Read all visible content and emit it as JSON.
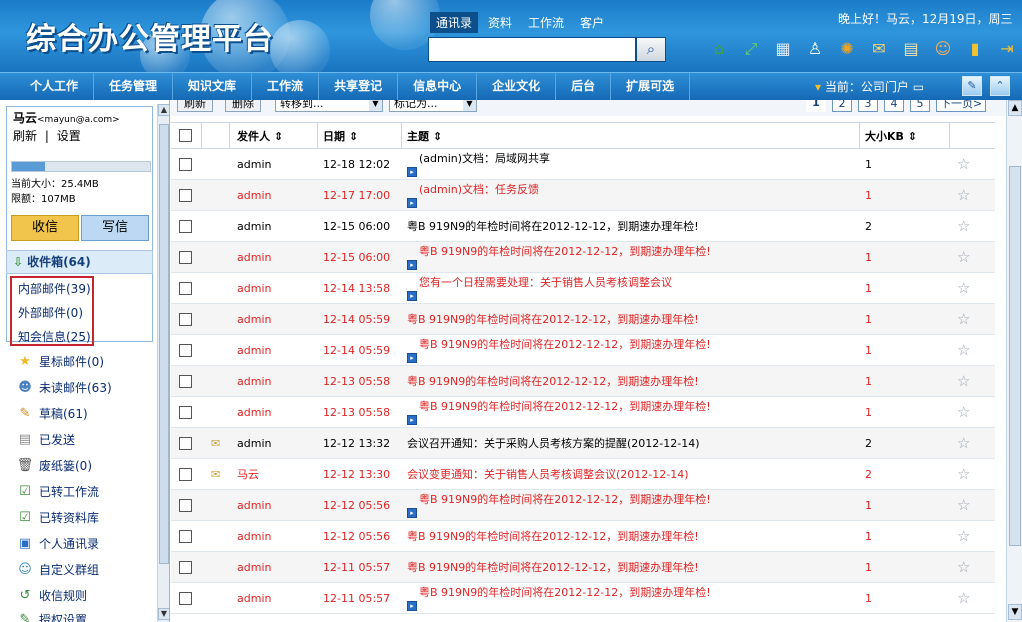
{
  "header": {
    "logo": "综合办公管理平台",
    "search_tabs": [
      "通讯录",
      "资料",
      "工作流",
      "客户"
    ],
    "active_search_tab": 0,
    "search_placeholder": "",
    "greeting": "晚上好！马云，12月19日，周三",
    "tool_icons": [
      "home-icon",
      "arrows-icon",
      "calendar-edit-icon",
      "shirt-icon",
      "gear-icon",
      "mail-icon",
      "calendar-icon",
      "people-icon",
      "notebook-icon",
      "exit-icon"
    ]
  },
  "nav": {
    "items": [
      "个人工作",
      "任务管理",
      "知识文库",
      "工作流",
      "共享登记",
      "信息中心",
      "企业文化",
      "后台",
      "扩展可选"
    ],
    "current": "当前：公司门户"
  },
  "left": {
    "user_name": "马云",
    "user_email": "<mayun@a.com>",
    "refresh": "刷新",
    "separator": "|",
    "settings": "设置",
    "quota_fill_fraction": 0.24,
    "current_size": "当前大小：25.4MB",
    "limit": "限额：107MB",
    "receive_btn": "收信",
    "write_btn": "写信",
    "inbox": "收件箱(64)",
    "sub_items": [
      "内部邮件(39)",
      "外部邮件(0)",
      "知会信息(25)"
    ],
    "menu_items": [
      {
        "label": "星标邮件(0)",
        "icon": "star-icon"
      },
      {
        "label": "未读邮件(63)",
        "icon": "unread-icon"
      },
      {
        "label": "草稿(61)",
        "icon": "draft-icon"
      },
      {
        "label": "已发送",
        "icon": "sent-icon"
      },
      {
        "label": "废纸篓(0)",
        "icon": "trash-icon"
      },
      {
        "label": "已转工作流",
        "icon": "workflow-icon"
      },
      {
        "label": "已转资料库",
        "icon": "library-icon"
      },
      {
        "label": "个人通讯录",
        "icon": "contacts-icon"
      },
      {
        "label": "自定义群组",
        "icon": "group-icon"
      },
      {
        "label": "收信规则",
        "icon": "rules-icon"
      },
      {
        "label": "授权设置",
        "icon": "auth-icon"
      }
    ]
  },
  "toolbar": {
    "refresh": "刷新",
    "delete": "删除",
    "move_to": "转移到...",
    "mark_as": "标记为...",
    "pages": [
      "1",
      "2",
      "3",
      "4",
      "5",
      "下一页>"
    ]
  },
  "table": {
    "headers": {
      "sender": "发件人 ⇕",
      "date": "日期 ⇕",
      "subject": "主题 ⇕",
      "size": "大小KB ⇕"
    },
    "rows": [
      {
        "sender": "admin",
        "date": "12-18 12:02",
        "subject": "(admin)文档：局域网共享",
        "size": "1",
        "red": false,
        "env": false,
        "flag": true
      },
      {
        "sender": "admin",
        "date": "12-17 17:00",
        "subject": "(admin)文档：任务反馈",
        "size": "1",
        "red": true,
        "env": false,
        "flag": true
      },
      {
        "sender": "admin",
        "date": "12-15 06:00",
        "subject": "粤B 919N9的年检时间将在2012-12-12，到期速办理年检!",
        "size": "2",
        "red": false,
        "env": false,
        "flag": false
      },
      {
        "sender": "admin",
        "date": "12-15 06:00",
        "subject": "粤B 919N9的年检时间将在2012-12-12，到期速办理年检!",
        "size": "1",
        "red": true,
        "env": false,
        "flag": true
      },
      {
        "sender": "admin",
        "date": "12-14 13:58",
        "subject": "您有一个日程需要处理：关于销售人员考核调整会议",
        "size": "1",
        "red": true,
        "env": false,
        "flag": true
      },
      {
        "sender": "admin",
        "date": "12-14 05:59",
        "subject": "粤B 919N9的年检时间将在2012-12-12，到期速办理年检!",
        "size": "1",
        "red": true,
        "env": false,
        "flag": false
      },
      {
        "sender": "admin",
        "date": "12-14 05:59",
        "subject": "粤B 919N9的年检时间将在2012-12-12，到期速办理年检!",
        "size": "1",
        "red": true,
        "env": false,
        "flag": true
      },
      {
        "sender": "admin",
        "date": "12-13 05:58",
        "subject": "粤B 919N9的年检时间将在2012-12-12，到期速办理年检!",
        "size": "1",
        "red": true,
        "env": false,
        "flag": false
      },
      {
        "sender": "admin",
        "date": "12-13 05:58",
        "subject": "粤B 919N9的年检时间将在2012-12-12，到期速办理年检!",
        "size": "1",
        "red": true,
        "env": false,
        "flag": true
      },
      {
        "sender": "admin",
        "date": "12-12 13:32",
        "subject": "会议召开通知：关于采购人员考核方案的提醒(2012-12-14)",
        "size": "2",
        "red": false,
        "env": true,
        "flag": false
      },
      {
        "sender": "马云",
        "date": "12-12 13:30",
        "subject": "会议变更通知：关于销售人员考核调整会议(2012-12-14)",
        "size": "2",
        "red": true,
        "env": true,
        "flag": false
      },
      {
        "sender": "admin",
        "date": "12-12 05:56",
        "subject": "粤B 919N9的年检时间将在2012-12-12，到期速办理年检!",
        "size": "1",
        "red": true,
        "env": false,
        "flag": true
      },
      {
        "sender": "admin",
        "date": "12-12 05:56",
        "subject": "粤B 919N9的年检时间将在2012-12-12，到期速办理年检!",
        "size": "1",
        "red": true,
        "env": false,
        "flag": false
      },
      {
        "sender": "admin",
        "date": "12-11 05:57",
        "subject": "粤B 919N9的年检时间将在2012-12-12，到期速办理年检!",
        "size": "1",
        "red": true,
        "env": false,
        "flag": false
      },
      {
        "sender": "admin",
        "date": "12-11 05:57",
        "subject": "粤B 919N9的年检时间将在2012-12-12，到期速办理年检!",
        "size": "1",
        "red": true,
        "env": false,
        "flag": true
      }
    ]
  },
  "colors": {
    "red_text": "#e02424",
    "header_blue": "#1b7cc9",
    "nav_blue": "#1569b5"
  }
}
